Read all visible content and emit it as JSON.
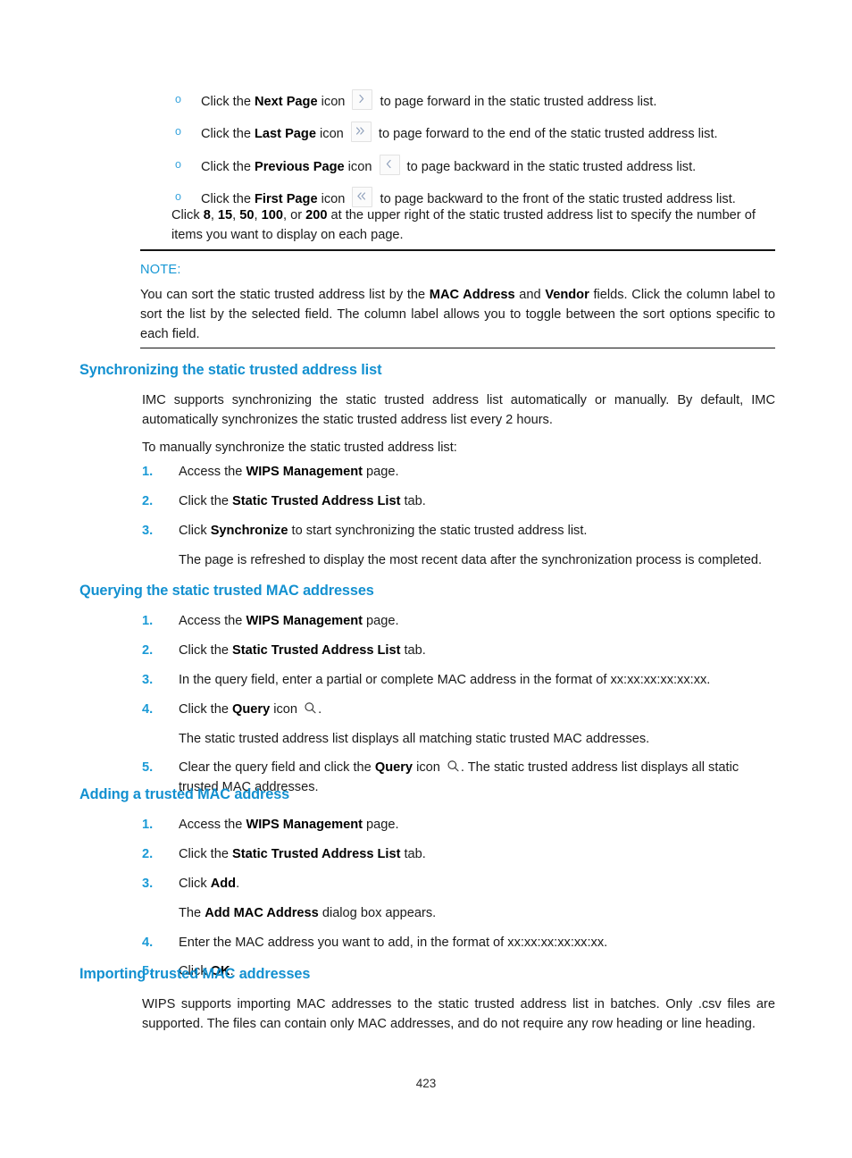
{
  "document": {
    "page_number": "423"
  },
  "pager_bullets": {
    "marker": "o",
    "items": [
      {
        "lead": "Click the ",
        "bold": "Next Page",
        "mid": " icon ",
        "icon": "chevron-right-icon",
        "tail": " to page forward in the static trusted address list."
      },
      {
        "lead": "Click the ",
        "bold": "Last Page",
        "mid": " icon ",
        "icon": "chevron-double-right-icon",
        "tail": " to page forward to the end of the static trusted address list."
      },
      {
        "lead": "Click the ",
        "bold": "Previous Page",
        "mid": " icon ",
        "icon": "chevron-left-icon",
        "tail": " to page backward in the static trusted address list."
      },
      {
        "lead": "Click the ",
        "bold": "First Page",
        "mid": " icon ",
        "icon": "chevron-double-left-icon",
        "tail": " to page backward to the front of the static trusted address list."
      }
    ]
  },
  "page_size_paragraph": {
    "p1": "Click ",
    "b1": "8",
    "s1": ", ",
    "b2": "15",
    "s2": ", ",
    "b3": "50",
    "s3": ", ",
    "b4": "100",
    "s4": ", or ",
    "b5": "200",
    "tail": " at the upper right of the static trusted address list to specify the number of items you want to display on each page."
  },
  "note": {
    "label": "NOTE:",
    "p1": "You can sort the static trusted address list by the ",
    "b1": "MAC Address",
    "p2": " and ",
    "b2": "Vendor",
    "p3": " fields. Click the column label to sort the list by the selected field. The column label allows you to toggle between the sort options specific to each field."
  },
  "sections": [
    {
      "heading": "Synchronizing the static trusted address list",
      "intro": "IMC supports synchronizing the static trusted address list automatically or manually. By default, IMC automatically synchronizes the static trusted address list every 2 hours.",
      "lead_in": "To manually synchronize the static trusted address list:",
      "steps": [
        {
          "num": "1.",
          "pre": "Access the ",
          "bold": "WIPS Management",
          "post": " page."
        },
        {
          "num": "2.",
          "pre": "Click the ",
          "bold": "Static Trusted Address List",
          "post": " tab."
        },
        {
          "num": "3.",
          "pre": "Click ",
          "bold": "Synchronize",
          "post": " to start synchronizing the static trusted address list.",
          "sub": "The page is refreshed to display the most recent data after the synchronization process is completed."
        }
      ]
    },
    {
      "heading": "Querying the static trusted MAC addresses",
      "steps": [
        {
          "num": "1.",
          "pre": "Access the ",
          "bold": "WIPS Management",
          "post": " page."
        },
        {
          "num": "2.",
          "pre": "Click the ",
          "bold": "Static Trusted Address List",
          "post": " tab."
        },
        {
          "num": "3.",
          "pre": "In the query field, enter a partial or complete MAC address in the format of xx:xx:xx:xx:xx:xx.",
          "bold": "",
          "post": ""
        },
        {
          "num": "4.",
          "pre": "Click the ",
          "bold": "Query",
          "post": " icon ",
          "icon": "search-icon",
          "after_icon": ".",
          "sub": "The static trusted address list displays all matching static trusted MAC addresses."
        },
        {
          "num": "5.",
          "pre": "Clear the query field and click the ",
          "bold": "Query",
          "post": " icon ",
          "icon": "search-icon",
          "after_icon": ". The static trusted address list displays all static trusted MAC addresses."
        }
      ]
    },
    {
      "heading": "Adding a trusted MAC address",
      "steps": [
        {
          "num": "1.",
          "pre": "Access the ",
          "bold": "WIPS Management",
          "post": " page."
        },
        {
          "num": "2.",
          "pre": "Click the ",
          "bold": "Static Trusted Address List",
          "post": " tab."
        },
        {
          "num": "3.",
          "pre": "Click ",
          "bold": "Add",
          "post": ".",
          "sub_pre": "The ",
          "sub_bold": "Add MAC Address",
          "sub_post": " dialog box appears."
        },
        {
          "num": "4.",
          "pre": "Enter the MAC address you want to add, in the format of xx:xx:xx:xx:xx:xx.",
          "bold": "",
          "post": ""
        },
        {
          "num": "5.",
          "pre": "Click ",
          "bold": "OK",
          "post": "."
        }
      ]
    },
    {
      "heading": "Importing trusted MAC addresses",
      "intro": "WIPS supports importing MAC addresses to the static trusted address list in batches. Only .csv files are supported. The files can contain only MAC addresses, and do not require any row heading or line heading."
    }
  ],
  "colors": {
    "heading_blue": "#1290d0",
    "note_blue": "#1898d5",
    "step_number_blue": "#1b9ad6",
    "bullet_blue": "#38a4dd",
    "body_black": "#1a1a1a"
  }
}
